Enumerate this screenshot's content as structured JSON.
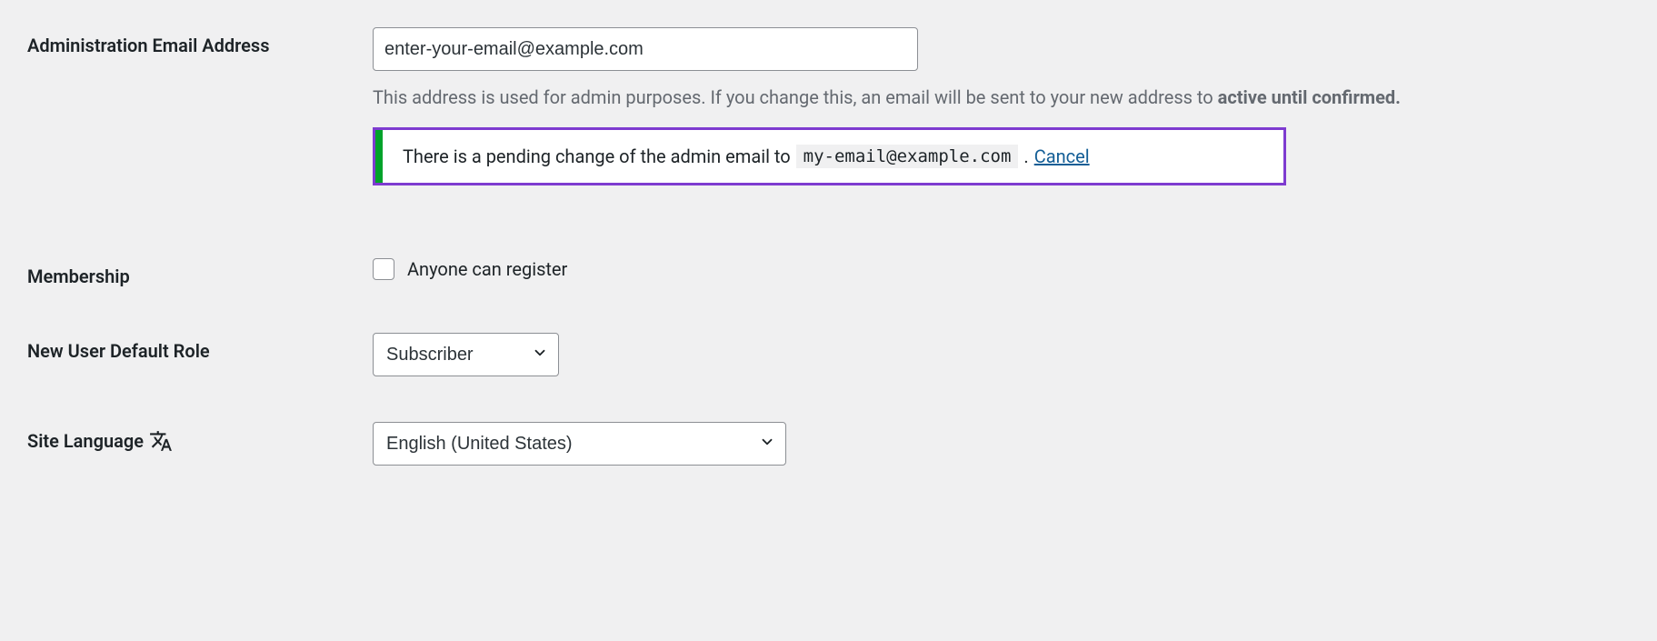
{
  "admin_email": {
    "label": "Administration Email Address",
    "value": "enter-your-email@example.com",
    "description_part1": "This address is used for admin purposes. If you change this, an email will be sent to your new address to ",
    "description_bold": "active until confirmed.",
    "notice_text": "There is a pending change of the admin email to",
    "notice_email": "my-email@example.com",
    "notice_dot": ".",
    "notice_cancel": "Cancel"
  },
  "membership": {
    "label": "Membership",
    "checkbox_label": "Anyone can register"
  },
  "default_role": {
    "label": "New User Default Role",
    "selected": "Subscriber"
  },
  "site_language": {
    "label": "Site Language",
    "selected": "English (United States)"
  }
}
